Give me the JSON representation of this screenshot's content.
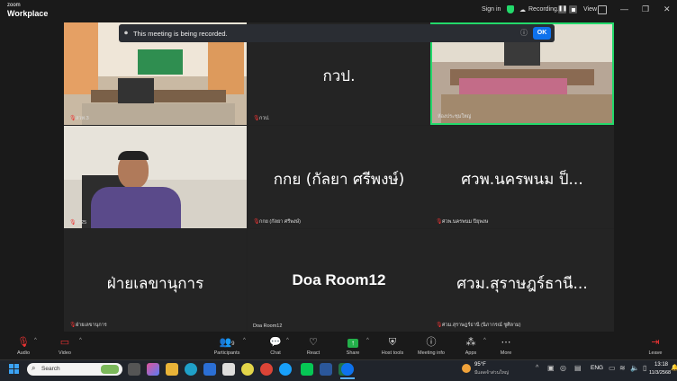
{
  "app": {
    "brand_small": "zoom",
    "brand_big": "Workplace"
  },
  "topbar": {
    "signin": "Sign in",
    "recording": "Recording...",
    "view": "View"
  },
  "banner": {
    "text": "This meeting is being recorded.",
    "ok": "OK"
  },
  "tiles": [
    {
      "name": "สวท.3",
      "type": "video"
    },
    {
      "big": "กวป.",
      "name": "กวป."
    },
    {
      "name": "ห้องประชุมใหญ่",
      "type": "video"
    },
    {
      "name": "9225",
      "type": "video"
    },
    {
      "big": "กกย (กัลยา ศรีพงษ์)",
      "name": "กกย (กัลยา ศรีพงษ์)"
    },
    {
      "big": "ศวพ.นครพนม ป็...",
      "name": "ศวพ.นครพนม ปิยุพงษ"
    },
    {
      "big": "ฝ่ายเลขานุการ",
      "name": "ฝ่ายเลขานุการ"
    },
    {
      "big": "Doa Room12",
      "name": "Doa Room12"
    },
    {
      "big": "ศวม.สุราษฎร์ธานี...",
      "name": "ศวม.สุราษฎร์ธานี (นิภากรณ์ ชูศิลาม)"
    }
  ],
  "toolbar": {
    "audio": "Audio",
    "video": "Video",
    "participants": "Participants",
    "participants_count": "9",
    "chat": "Chat",
    "react": "React",
    "share": "Share",
    "host_tools": "Host tools",
    "meeting_info": "Meeting info",
    "apps": "Apps",
    "more": "More",
    "leave": "Leave"
  },
  "taskbar": {
    "search": "Search",
    "weather_temp": "95°F",
    "weather_desc": "มีแดดจ้าส่วนใหญ่",
    "lang": "ENG",
    "time": "13:18",
    "date": "11/3/2568"
  },
  "colors": {
    "accent": "#0e72ed",
    "active_speaker": "#23d96b",
    "recording": "#e33"
  }
}
